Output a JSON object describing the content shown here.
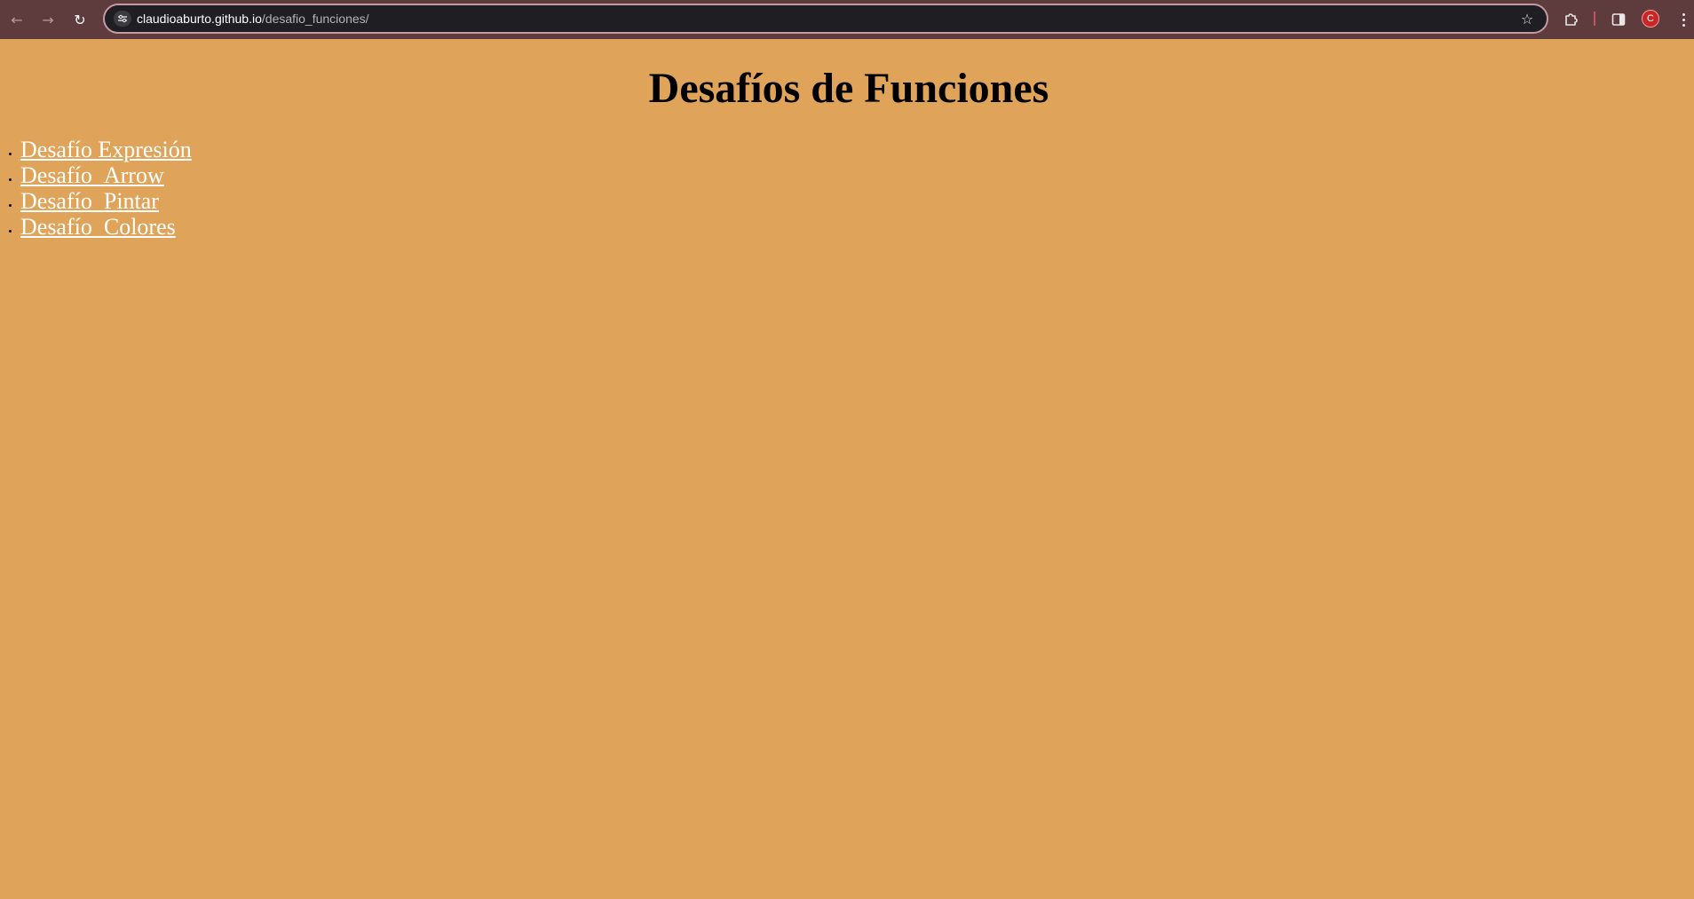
{
  "browser": {
    "url_host": "claudioaburto.github.io",
    "url_path": "/desafio_funciones/",
    "profile_initial": "C",
    "icons": {
      "back": "arrow-left-icon",
      "forward": "arrow-right-icon",
      "reload": "reload-icon",
      "site_info": "tune-icon",
      "bookmark": "star-icon",
      "extensions": "puzzle-icon",
      "side_panel": "side-panel-icon",
      "menu": "kebab-menu-icon"
    },
    "colors": {
      "toolbar": "#5e3b3d",
      "omnibox": "#1f1f23",
      "profile": "#c62828"
    }
  },
  "page": {
    "title": "Desafíos de Funciones",
    "background": "#dfa45a",
    "links": [
      {
        "label": "Desafío Expresión"
      },
      {
        "label": "Desafío_Arrow"
      },
      {
        "label": "Desafío_Pintar"
      },
      {
        "label": "Desafío_Colores"
      }
    ]
  }
}
